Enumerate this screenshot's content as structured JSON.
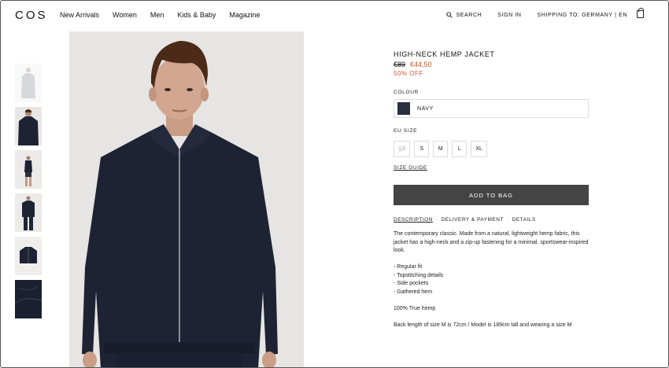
{
  "header": {
    "logo": "COS",
    "nav": [
      "New Arrivals",
      "Women",
      "Men",
      "Kids & Baby",
      "Magazine"
    ],
    "search_label": "SEARCH",
    "sign_in_label": "SIGN IN",
    "shipping_label": "SHIPPING TO: GERMANY | EN"
  },
  "product": {
    "title": "HIGH-NECK HEMP JACKET",
    "old_price": "€89",
    "new_price": "€44,50",
    "discount": "50% OFF",
    "colour_label": "COLOUR",
    "colour_name": "NAVY",
    "colour_hex": "#2a2f3c",
    "size_label": "EU SIZE",
    "sizes": [
      "XS",
      "S",
      "M",
      "L",
      "XL"
    ],
    "size_guide": "SIZE GUIDE",
    "add_to_bag": "ADD TO BAG",
    "tabs": [
      "DESCRIPTION",
      "DELIVERY & PAYMENT",
      "DETAILS"
    ],
    "description": "The contemporary classic. Made from a natural, lightweight hemp fabric, this jacket has a high-neck and a zip-up fastening for a minimal, sportswear-inspired look.",
    "features": [
      "- Regular fit",
      "- Topstitching details",
      "- Side pockets",
      "- Gathered hem"
    ],
    "material": "100% True hemp",
    "fit_note": "Back length of size M is 72cm / Model is 189cm tall and wearing a size M"
  },
  "colors": {
    "accent": "#d0582e",
    "button_bg": "#444444"
  }
}
